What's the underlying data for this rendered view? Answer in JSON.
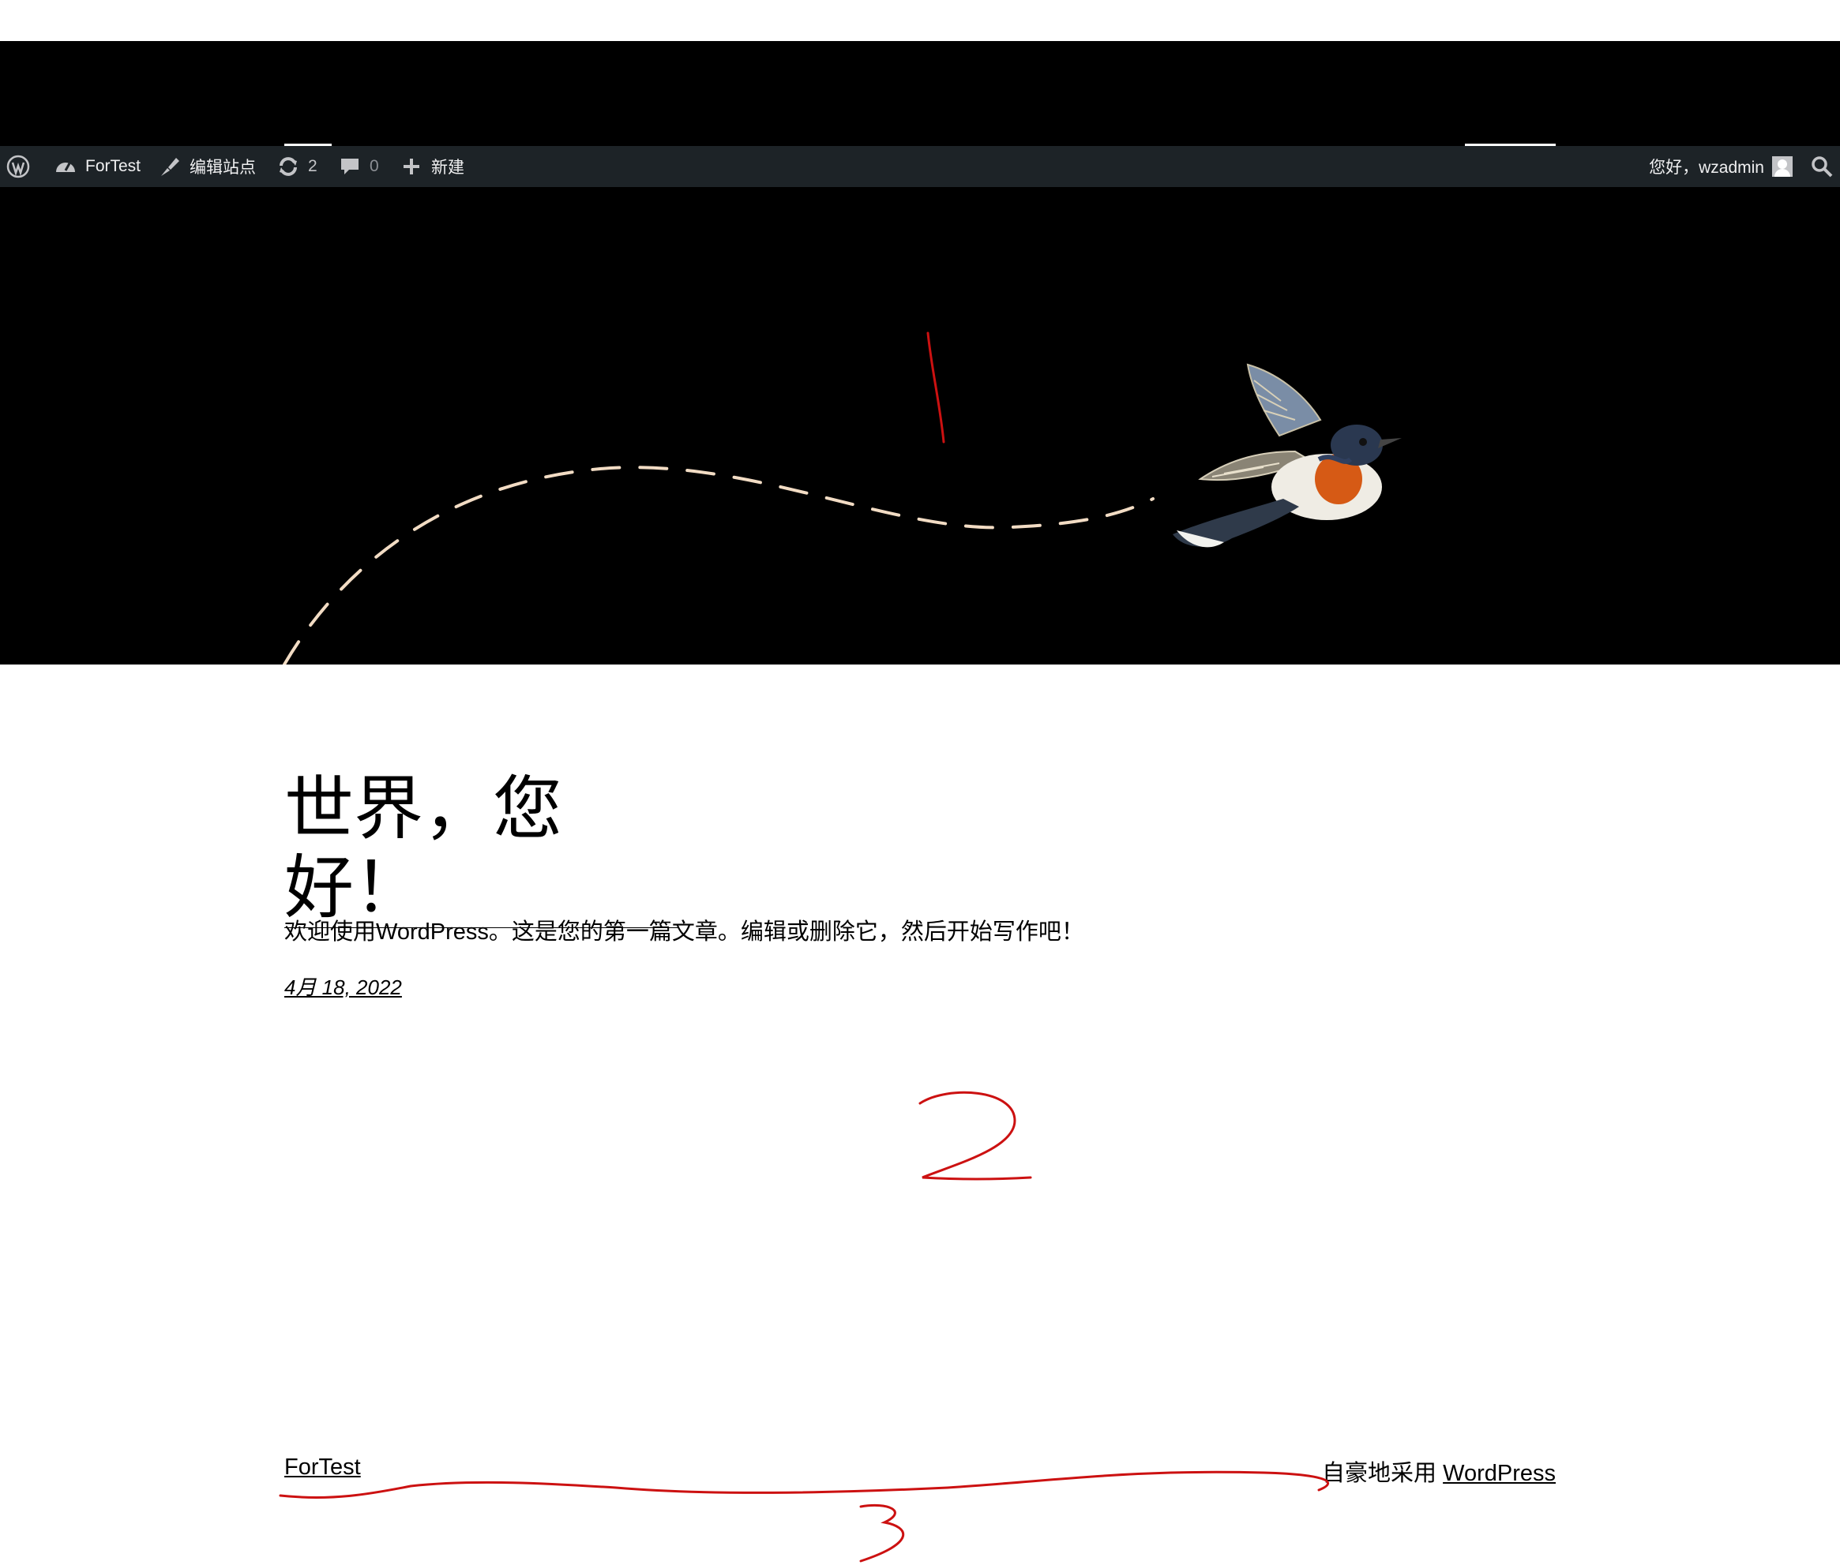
{
  "admin_bar": {
    "site_name": "ForTest",
    "edit_site": "编辑站点",
    "updates_count": "2",
    "comments_count": "0",
    "new_label": "新建",
    "greeting": "您好，wzadmin"
  },
  "post": {
    "title": "世界，您好！",
    "body": "欢迎使用WordPress。这是您的第一篇文章。编辑或删除它，然后开始写作吧！",
    "date": "4月 18, 2022"
  },
  "footer": {
    "site_title": "ForTest",
    "credit_prefix": "自豪地采用 ",
    "credit_link": "WordPress"
  },
  "annotations": {
    "mark_1": "1",
    "mark_2": "2",
    "mark_3": "3"
  },
  "colors": {
    "admin_bar_bg": "#1d2327",
    "hero_bg": "#000000",
    "annotation_red": "#cc1111",
    "flight_path": "#f2dcc4"
  }
}
